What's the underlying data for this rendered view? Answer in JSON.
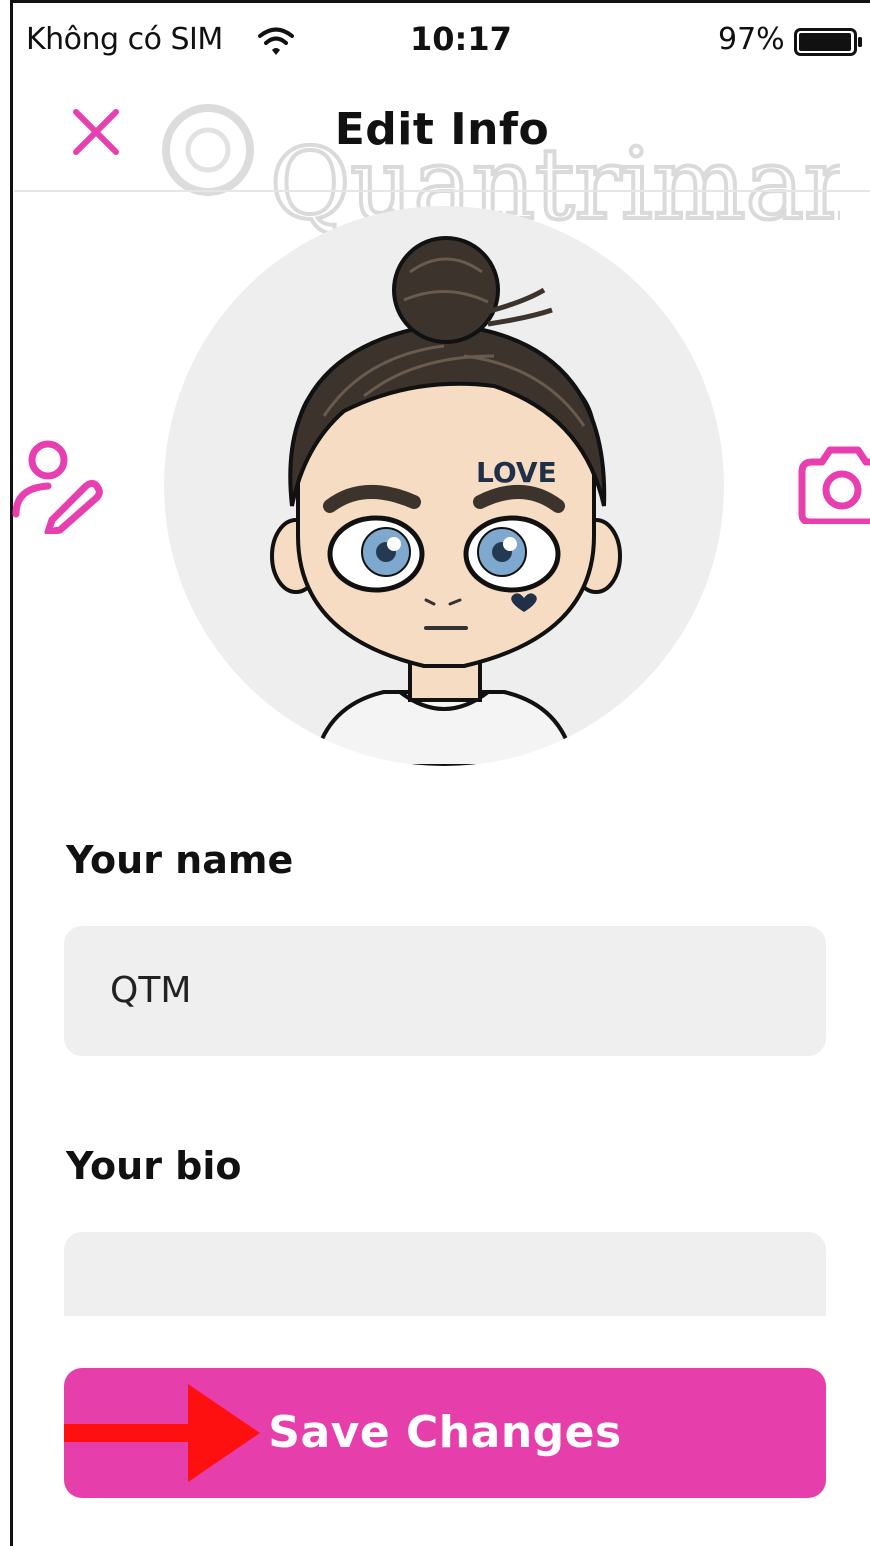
{
  "status_bar": {
    "carrier": "Không có SIM",
    "time": "10:17",
    "battery": "97%",
    "icons": [
      "wifi-icon",
      "battery-icon"
    ]
  },
  "header": {
    "title": "Edit Info",
    "close_icon": "close-icon"
  },
  "watermark": {
    "text": "Quantrimang"
  },
  "avatar": {
    "tattoo_text": "LOVE",
    "edit_icon": "edit-avatar-icon",
    "camera_icon": "camera-icon"
  },
  "form": {
    "name_label": "Your name",
    "name_value": "QTM",
    "bio_label": "Your bio",
    "bio_value": ""
  },
  "actions": {
    "save_label": "Save Changes"
  },
  "colors": {
    "accent": "#E63EAA",
    "icon_pink": "#E83FB0",
    "input_bg": "#EFEFEF",
    "avatar_bg": "#EEEEEE",
    "arrow": "#FF0000"
  }
}
